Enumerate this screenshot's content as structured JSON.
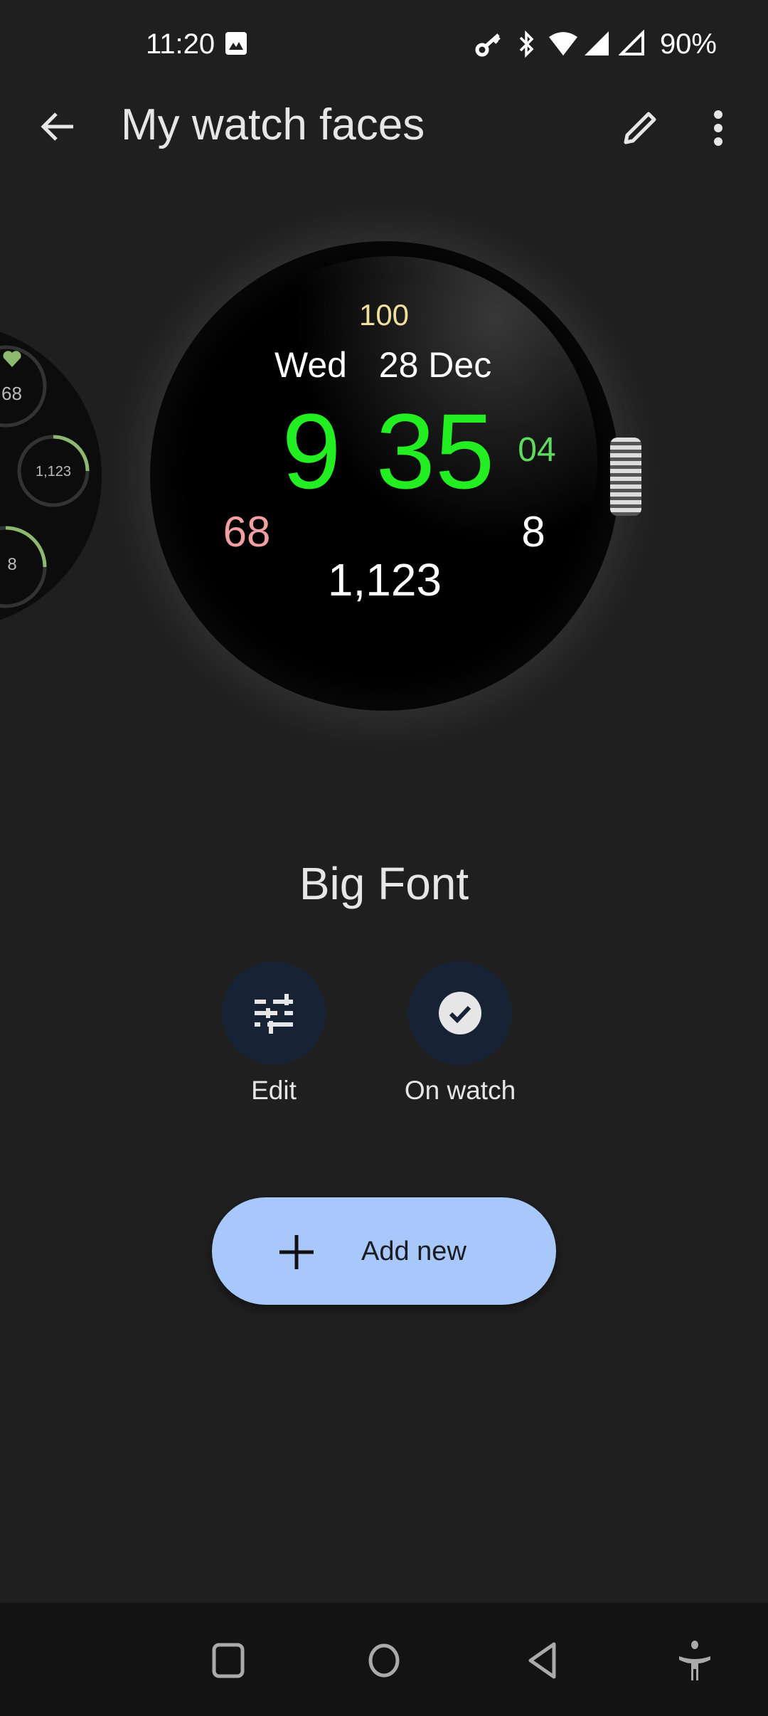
{
  "status_bar": {
    "time": "11:20",
    "battery": "90%",
    "icons": [
      "image-icon",
      "vpn-key-icon",
      "bluetooth-icon",
      "wifi-icon",
      "signal-icon",
      "signal-icon"
    ]
  },
  "app_bar": {
    "title": "My watch faces",
    "icons": [
      "back-arrow-icon",
      "pencil-icon",
      "more-vert-icon"
    ]
  },
  "watch_preview": {
    "battery": "100",
    "day": "Wed",
    "date": "28 Dec",
    "hour": "9",
    "minute": "35",
    "seconds": "04",
    "heart_rate": "68",
    "floors": "8",
    "steps": "1,123",
    "colors": {
      "time": "#22ee22",
      "seconds": "#5fdc5f",
      "battery": "#f0e0a0",
      "heart_rate": "#f0a0a0"
    }
  },
  "prev_watch_preview": {
    "heart_rate": "68",
    "steps": "1,123",
    "floors": "8",
    "accent": "#8db870"
  },
  "face_name": "Big Font",
  "actions": [
    {
      "label": "Edit",
      "icon": "tune-icon"
    },
    {
      "label": "On watch",
      "icon": "check-circle-icon"
    }
  ],
  "add_button": {
    "label": "Add new",
    "icon": "plus-icon",
    "color": "#a8c7fa"
  },
  "nav_bar": {
    "icons": [
      "recents-icon",
      "home-icon",
      "back-icon",
      "accessibility-icon"
    ]
  }
}
